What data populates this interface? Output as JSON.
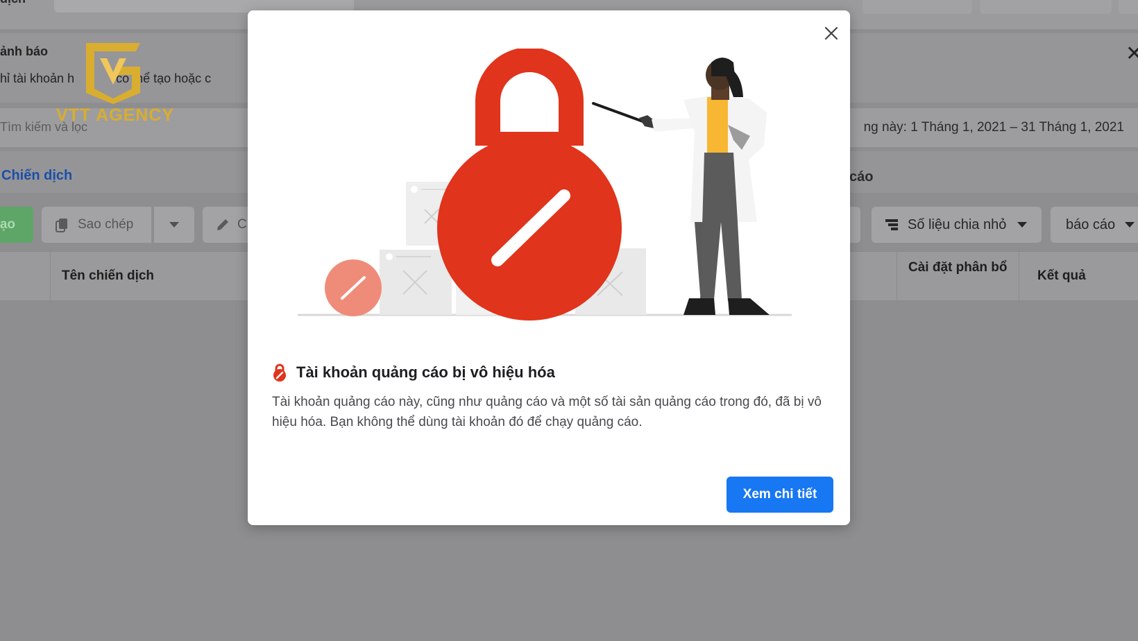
{
  "background": {
    "topbar_fragment": "dịch",
    "warning": {
      "title": "ảnh báo",
      "description": "hỉ tài khoản h",
      "description_tail": "có thể tạo hoặc c"
    },
    "search_placeholder": "Tìm kiếm và lọc",
    "date_range": "ng này: 1 Tháng 1, 2021 – 31 Tháng 1, 2021",
    "tabs": {
      "campaign": "Chiến dịch",
      "report_fragment": "cáo"
    },
    "toolbar": {
      "create": "ạo",
      "copy": "Sao chép",
      "edit_fragment": "C",
      "breakdown": "Số liệu chia nhỏ",
      "report": "báo cáo"
    },
    "table_headers": {
      "campaign_name": "Tên chiến dịch",
      "allocation": "Cài đặt phân bổ",
      "result": "Kết quả"
    }
  },
  "watermark": {
    "text": "VTT AGENCY",
    "color": "#d9ad2f"
  },
  "modal": {
    "title": "Tài khoản quảng cáo bị vô hiệu hóa",
    "body": "Tài khoản quảng cáo này, cũng như quảng cáo và một số tài sản quảng cáo trong đó, đã bị vô hiệu hóa. Bạn không thể dùng tài khoản đó để chạy quảng cáo.",
    "button_label": "Xem chi tiết",
    "title_icon": "lock-disabled-icon",
    "close_icon": "close-icon",
    "accent_color": "#1877f2",
    "lock_color": "#e0341c"
  }
}
